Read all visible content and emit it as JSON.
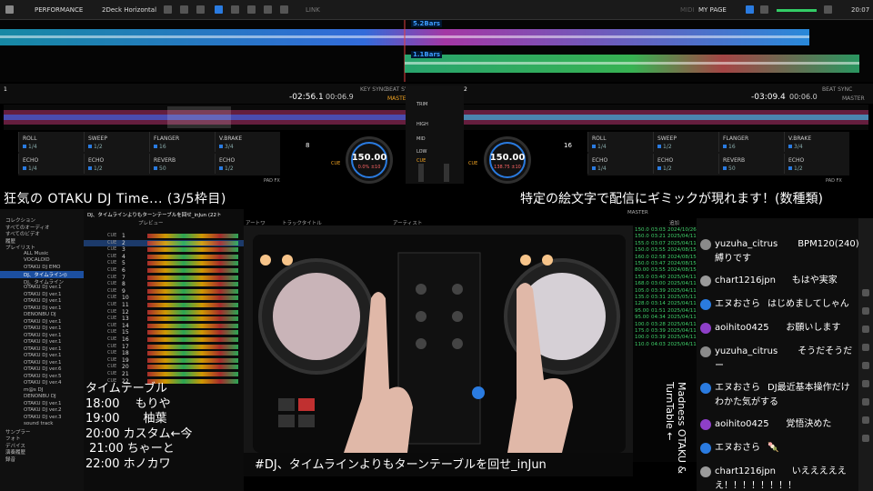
{
  "topbar": {
    "mode": "PERFORMANCE",
    "layout": "2Deck Horizontal",
    "link": "LINK",
    "my_page": "MY PAGE",
    "midi": "MIDI",
    "clock": "20:07"
  },
  "overview": {
    "tag1": "5.2Bars",
    "tag2": "1.1Bars"
  },
  "deck1": {
    "number": "1",
    "remain": "-02:56.1",
    "elapsed": "00:06.9",
    "key_sync_label": "KEY SYNC",
    "beat_sync_label": "BEAT SYNC",
    "master_label": "MASTER",
    "bpm": "150.00",
    "pitch": "0.0%  ±10",
    "beat_jump": "8",
    "fx": [
      "ROLL",
      "SWEEP",
      "FLANGER",
      "V.BRAKE",
      "ECHO",
      "ECHO",
      "REVERB",
      "ECHO"
    ],
    "fx_vals": [
      "1/4",
      "1/2",
      "16",
      "3/4",
      "1/4",
      "1/2",
      "50",
      "1/2"
    ],
    "pad_fx": "PAD FX",
    "cue": "CUE"
  },
  "deck2": {
    "number": "2",
    "remain": "-03:09.4",
    "elapsed": "00:06.0",
    "beat_sync_label": "BEAT SYNC",
    "master_label": "MASTER",
    "bpm": "150.00",
    "pitch": "138.75  ±10",
    "beat_jump": "16",
    "fx": [
      "ROLL",
      "SWEEP",
      "FLANGER",
      "V.BRAKE",
      "ECHO",
      "ECHO",
      "REVERB",
      "ECHO"
    ],
    "fx_vals": [
      "1/4",
      "1/2",
      "16",
      "3/4",
      "1/4",
      "1/2",
      "50",
      "1/2"
    ],
    "pad_fx": "PAD FX",
    "cue": "CUE"
  },
  "mixer": {
    "trim": "TRIM",
    "hi": "HIGH",
    "mid": "MID",
    "low": "LOW",
    "cue": "CUE"
  },
  "overlay": {
    "title_left": "狂気の OTAKU DJ Time... (3/5枠目)",
    "title_right": "特定の絵文字で配信にギミックが現れます！(数種類)",
    "caption": "#DJ、タイムラインよりもターンテーブルを回せ_inJun",
    "vertical": "Madness OTAKU & TurnTable ←",
    "schedule": [
      "タイムテーブル",
      "18:00　 もりや",
      "19:00　　柚葉",
      "20:00 カスタム←今",
      " 21:00 ちゃーと",
      "22:00 ホノカワ"
    ]
  },
  "browser": {
    "header": "DJ、タイムラインよりもターンテーブルを回せ_inJun (22ト",
    "columns": [
      "プレビュー",
      "アートワ",
      "トラックタイトル",
      "アーティスト"
    ],
    "master": "MASTER",
    "added": "追加",
    "sidebar": [
      "コレクション",
      "すべてのオーディオ",
      "すべてのビデオ",
      "履歴",
      "プレイリスト",
      "ALL Music",
      "VOCALOID",
      "OTAKU DJ EMO",
      "DJ、タイムライン(i",
      "DJ、タイムライン",
      "OTAKU DJ ver.1",
      "OTAKU DJ ver.1",
      "OTAKU DJ ver.1",
      "OTAKU DJ ver.1",
      "DENONBU DJ",
      "OTAKU DJ ver.1",
      "OTAKU DJ ver.1",
      "OTAKU DJ ver.1",
      "OTAKU DJ ver.1",
      "OTAKU DJ ver.1",
      "OTAKU DJ ver.1",
      "OTAKU DJ ver.1",
      "OTAKU DJ ver.6",
      "OTAKU DJ ver.5",
      "OTAKU DJ ver.4",
      "m@s DJ",
      "DENONBU DJ",
      "OTAKU DJ ver.1",
      "OTAKU DJ ver.2",
      "OTAKU DJ ver.3",
      "sound track",
      "サンプラー",
      "フォト",
      "デバイス",
      "演奏履歴",
      "録音"
    ],
    "rows": [
      "1",
      "2",
      "3",
      "4",
      "5",
      "6",
      "7",
      "8",
      "9",
      "10",
      "11",
      "12",
      "13",
      "14",
      "15",
      "16",
      "17",
      "18",
      "19",
      "20",
      "21",
      "22"
    ]
  },
  "bpm_list": [
    [
      "150.0",
      "03:03",
      "2024/10/26"
    ],
    [
      "150.0",
      "03:21",
      "2025/04/11"
    ],
    [
      "155.0",
      "03:07",
      "2025/04/11"
    ],
    [
      "150.0",
      "03:55",
      "2024/08/15"
    ],
    [
      "160.0",
      "02:58",
      "2024/08/15"
    ],
    [
      "150.0",
      "03:47",
      "2024/08/15"
    ],
    [
      "80.00",
      "03:55",
      "2024/08/15"
    ],
    [
      "155.0",
      "03:40",
      "2025/04/11"
    ],
    [
      "168.0",
      "03:00",
      "2025/04/11"
    ],
    [
      "105.0",
      "03:39",
      "2025/04/11"
    ],
    [
      "135.0",
      "03:31",
      "2025/05/11"
    ],
    [
      "128.0",
      "03:14",
      "2025/04/11"
    ],
    [
      "95.00",
      "01:51",
      "2025/04/11"
    ],
    [
      "95.00",
      "04:34",
      "2025/04/11"
    ],
    [
      "100.0",
      "03:28",
      "2025/04/11"
    ],
    [
      "175.0",
      "03:39",
      "2025/04/11"
    ],
    [
      "100.0",
      "03:39",
      "2025/04/11"
    ],
    [
      "110.0",
      "04:03",
      "2025/04/11"
    ]
  ],
  "chat": [
    {
      "name": "yuzuha_citrus",
      "text": "BPM120(240)",
      "text2": "縛りです",
      "color": "#8a8a8a"
    },
    {
      "name": "chart1216jpn",
      "text": "もはや実家",
      "color": "#9a9a9a"
    },
    {
      "name": "エヌおさら",
      "text": "はじめましてしゃん",
      "color": "#2a7be0"
    },
    {
      "name": "aoihito0425",
      "text": "お願いします",
      "color": "#8e3fc8"
    },
    {
      "name": "yuzuha_citrus",
      "text": "そうだそうだ",
      "text2": "ー",
      "color": "#8a8a8a"
    },
    {
      "name": "エヌおさら",
      "text": "DJ最近基本操作だけ",
      "text2": "わかた気がする",
      "color": "#2a7be0"
    },
    {
      "name": "aoihito0425",
      "text": "覚悟決めた",
      "color": "#8e3fc8"
    },
    {
      "name": "エヌおさら",
      "text": "🍡",
      "color": "#2a7be0"
    },
    {
      "name": "chart1216jpn",
      "text": "いえええええ",
      "text2": "え！！！！！！！！",
      "color": "#9a9a9a"
    }
  ],
  "colors": {
    "accent": "#2a7be0",
    "cue": "#f5a623",
    "waveform_blue": "#2fa0ff",
    "waveform_green": "#3fd06a"
  }
}
